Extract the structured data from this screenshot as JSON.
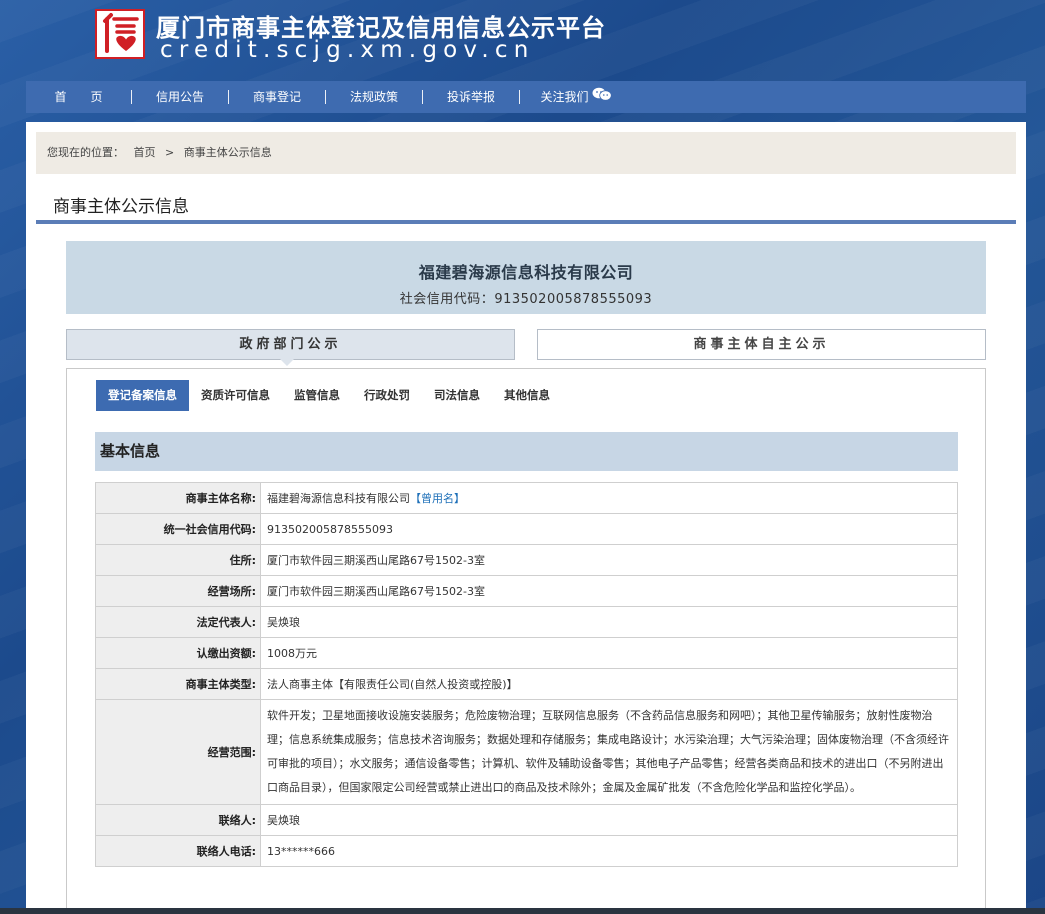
{
  "header": {
    "title": "厦门市商事主体登记及信用信息公示平台",
    "url": "credit.scjg.xm.gov.cn"
  },
  "nav": [
    {
      "label": "首　　页"
    },
    {
      "label": "信用公告"
    },
    {
      "label": "商事登记"
    },
    {
      "label": "法规政策"
    },
    {
      "label": "投诉举报"
    },
    {
      "label": "关注我们"
    }
  ],
  "breadcrumb": {
    "prefix": "您现在的位置：",
    "home": "首页",
    "sep": ">",
    "current": "商事主体公示信息"
  },
  "page_title": "商事主体公示信息",
  "company": {
    "name": "福建碧海源信息科技有限公司",
    "code_label": "社会信用代码：",
    "code": "913502005878555093"
  },
  "main_tabs": {
    "gov": "政府部门公示",
    "self": "商事主体自主公示"
  },
  "sub_tabs": [
    "登记备案信息",
    "资质许可信息",
    "监管信息",
    "行政处罚",
    "司法信息",
    "其他信息"
  ],
  "basic_info": {
    "heading": "基本信息",
    "former_name_link": "【曾用名】",
    "rows": [
      {
        "label": "商事主体名称:",
        "value": "福建碧海源信息科技有限公司"
      },
      {
        "label": "统一社会信用代码:",
        "value": "913502005878555093"
      },
      {
        "label": "住所:",
        "value": "厦门市软件园三期溪西山尾路67号1502-3室"
      },
      {
        "label": "经营场所:",
        "value": "厦门市软件园三期溪西山尾路67号1502-3室"
      },
      {
        "label": "法定代表人:",
        "value": "吴焕琅"
      },
      {
        "label": "认缴出资额:",
        "value": "1008万元"
      },
      {
        "label": "商事主体类型:",
        "value": "法人商事主体【有限责任公司(自然人投资或控股)】"
      },
      {
        "label": "经营范围:",
        "value": "软件开发；卫星地面接收设施安装服务；危险废物治理；互联网信息服务（不含药品信息服务和网吧）；其他卫星传输服务；放射性废物治理；信息系统集成服务；信息技术咨询服务；数据处理和存储服务；集成电路设计；水污染治理；大气污染治理；固体废物治理（不含须经许可审批的项目）；水文服务；通信设备零售；计算机、软件及辅助设备零售；其他电子产品零售；经营各类商品和技术的进出口（不另附进出口商品目录），但国家限定公司经营或禁止进出口的商品及技术除外；金属及金属矿批发（不含危险化学品和监控化学品）。"
      },
      {
        "label": "联络人:",
        "value": "吴焕琅"
      },
      {
        "label": "联络人电话:",
        "value": "13******666"
      }
    ]
  },
  "colors": {
    "nav_bg": "#3e6bb0",
    "accent": "#3d6bb1",
    "logo_red": "#d01f25"
  }
}
